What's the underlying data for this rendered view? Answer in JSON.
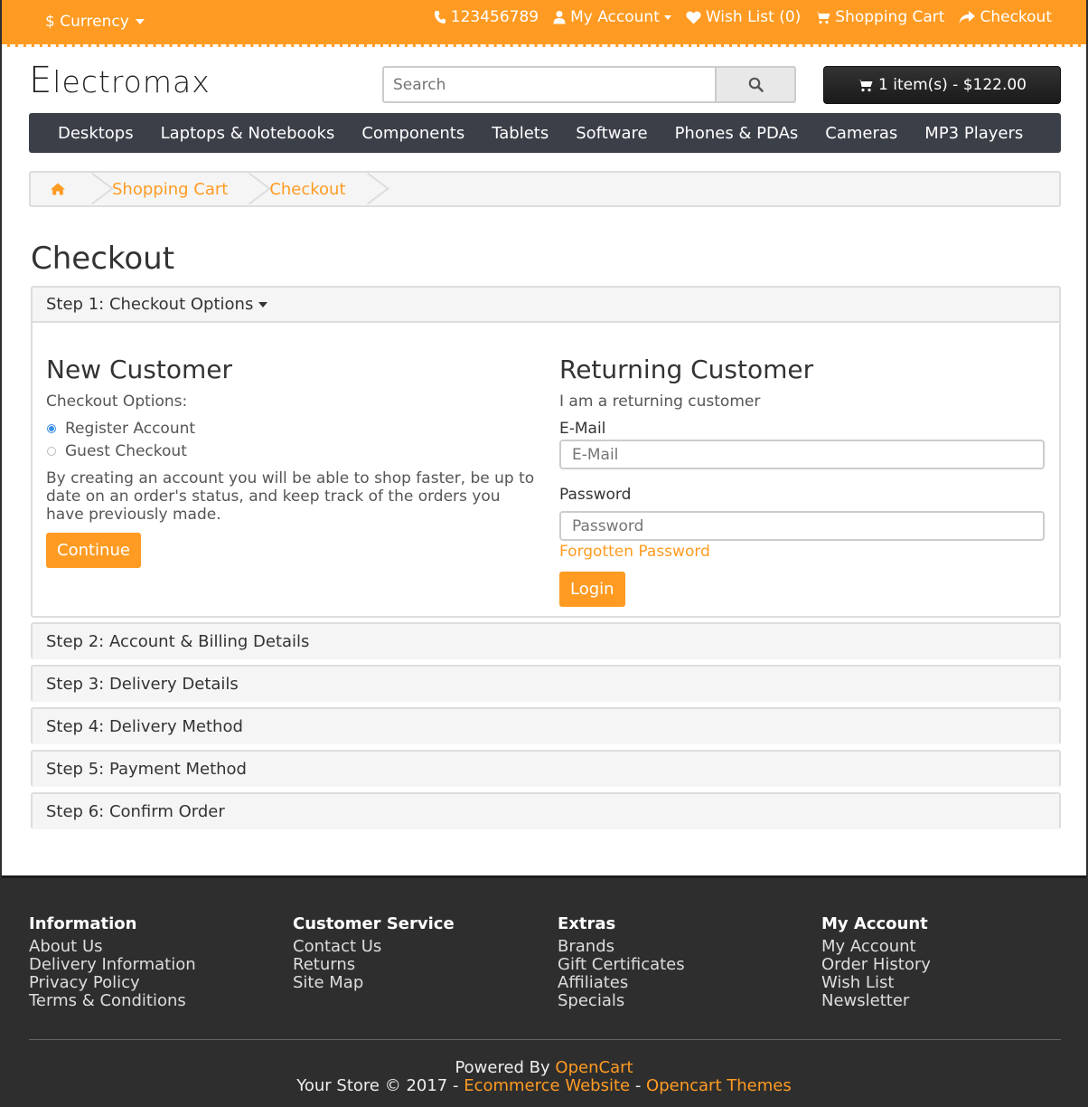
{
  "topbar": {
    "currency_label": "$ Currency",
    "phone": "123456789",
    "my_account": "My Account",
    "wish_list": "Wish List (0)",
    "shopping_cart": "Shopping Cart",
    "checkout": "Checkout"
  },
  "header": {
    "logo_first": "E",
    "logo_rest": "lectromax",
    "search_placeholder": "Search",
    "cart_label": "1 item(s) - $122.00"
  },
  "nav": {
    "items": [
      "Desktops",
      "Laptops & Notebooks",
      "Components",
      "Tablets",
      "Software",
      "Phones & PDAs",
      "Cameras",
      "MP3 Players"
    ]
  },
  "breadcrumb": {
    "items": [
      "Shopping Cart",
      "Checkout"
    ]
  },
  "page": {
    "title": "Checkout"
  },
  "checkout": {
    "step1": "Step 1: Checkout Options",
    "new_customer": {
      "heading": "New Customer",
      "options_label": "Checkout Options:",
      "option_register": "Register Account",
      "option_guest": "Guest Checkout",
      "selected": "register",
      "description": "By creating an account you will be able to shop faster, be up to date on an order's status, and keep track of the orders you have previously made.",
      "continue_button": "Continue"
    },
    "returning_customer": {
      "heading": "Returning Customer",
      "subtitle": "I am a returning customer",
      "email_label": "E-Mail",
      "email_placeholder": "E-Mail",
      "password_label": "Password",
      "password_placeholder": "Password",
      "forgotten": "Forgotten Password",
      "login_button": "Login"
    },
    "steps": [
      "Step 2: Account & Billing Details",
      "Step 3: Delivery Details",
      "Step 4: Delivery Method",
      "Step 5: Payment Method",
      "Step 6: Confirm Order"
    ]
  },
  "footer": {
    "columns": [
      {
        "title": "Information",
        "links": [
          "About Us",
          "Delivery Information",
          "Privacy Policy",
          "Terms & Conditions"
        ]
      },
      {
        "title": "Customer Service",
        "links": [
          "Contact Us",
          "Returns",
          "Site Map"
        ]
      },
      {
        "title": "Extras",
        "links": [
          "Brands",
          "Gift Certificates",
          "Affiliates",
          "Specials"
        ]
      },
      {
        "title": "My Account",
        "links": [
          "My Account",
          "Order History",
          "Wish List",
          "Newsletter"
        ]
      }
    ],
    "powered_prefix": "Powered By ",
    "powered_link": "OpenCart",
    "copyright_prefix": "Your Store © 2017 - ",
    "copyright_link1": "Ecommerce Website",
    "copyright_sep": " - ",
    "copyright_link2": "Opencart Themes"
  },
  "colors": {
    "accent": "#ff9b22",
    "nav_bg": "#3b3f48",
    "footer_bg": "#2e2e2e"
  }
}
